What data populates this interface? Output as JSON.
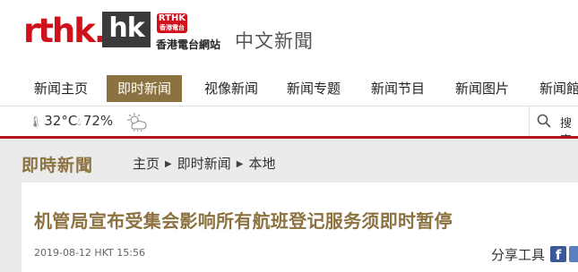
{
  "header": {
    "logo_text": "rthk",
    "logo_dot": ".",
    "logo_hk": "hk",
    "badge_line1": "RTHK",
    "badge_line2": "香港電台",
    "station_name": "香港電台網站",
    "section_name": "中文新聞"
  },
  "nav": {
    "items": [
      {
        "label": "新闻主页"
      },
      {
        "label": "即时新闻"
      },
      {
        "label": "视像新闻"
      },
      {
        "label": "新闻专题"
      },
      {
        "label": "新闻节目"
      },
      {
        "label": "新闻图片"
      },
      {
        "label": "新闻館"
      }
    ],
    "active_index": 1
  },
  "weather": {
    "temperature": "32°C",
    "humidity": "72%",
    "condition_icon": "cloudy-sun-icon",
    "search_label": "搜索"
  },
  "section": {
    "title": "即時新聞",
    "breadcrumb": [
      "主页",
      "即时新闻",
      "本地"
    ]
  },
  "article": {
    "headline": "机管局宣布受集会影响所有航班登记服务须即时暂停",
    "timestamp": "2019-08-12 HKT 15:56",
    "share_label": "分享工具"
  },
  "colors": {
    "brand_red": "#d0111b",
    "accent_gold": "#8c7240",
    "facebook": "#3b5998"
  }
}
